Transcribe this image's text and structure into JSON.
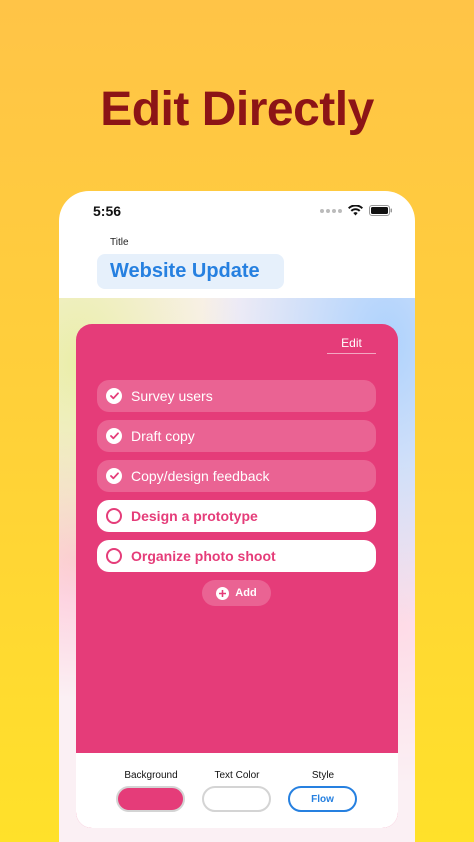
{
  "headline": "Edit Directly",
  "status_bar": {
    "time": "5:56"
  },
  "title": {
    "label": "Title",
    "value": "Website Update"
  },
  "card": {
    "edit_label": "Edit",
    "tasks": [
      {
        "label": "Survey users",
        "done": true
      },
      {
        "label": "Draft copy",
        "done": true
      },
      {
        "label": "Copy/design feedback",
        "done": true
      },
      {
        "label": "Design a prototype",
        "done": false
      },
      {
        "label": "Organize photo shoot",
        "done": false
      }
    ],
    "add_label": "Add"
  },
  "style_options": {
    "background_label": "Background",
    "text_color_label": "Text Color",
    "style_label": "Style",
    "style_value": "Flow"
  },
  "colors": {
    "accent_pink": "#e53c79",
    "headline_red": "#8c1416",
    "link_blue": "#2680e0"
  }
}
